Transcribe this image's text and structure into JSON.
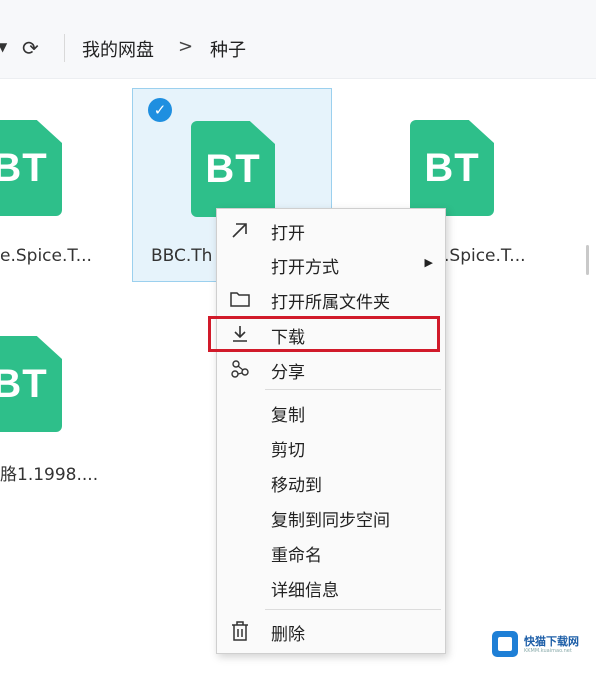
{
  "toolbar": {
    "dropdown_arrow": "▼",
    "refresh_glyph": "⟳",
    "breadcrumb": [
      "我的网盘",
      ">",
      "种子"
    ]
  },
  "files": [
    {
      "icon_text": "BT",
      "name": "e.Spice.T..."
    },
    {
      "icon_text": "BT",
      "name": "BBC.Th",
      "selected": true
    },
    {
      "icon_text": "BT",
      "name": ".Spice.T..."
    },
    {
      "icon_text": "BT",
      "name": "胳1.1998...."
    }
  ],
  "context_menu": {
    "items": [
      {
        "label": "打开",
        "icon": "arrow-up-right-icon"
      },
      {
        "label": "打开方式",
        "has_submenu": true
      },
      {
        "label": "打开所属文件夹",
        "icon": "folder-icon"
      },
      {
        "label": "下载",
        "icon": "download-icon",
        "highlighted": true
      },
      {
        "label": "分享",
        "icon": "share-icon"
      },
      {
        "label": "复制"
      },
      {
        "label": "剪切"
      },
      {
        "label": "移动到"
      },
      {
        "label": "复制到同步空间"
      },
      {
        "label": "重命名"
      },
      {
        "label": "详细信息"
      },
      {
        "label": "删除",
        "icon": "trash-icon"
      }
    ],
    "submenu_arrow": "▶"
  },
  "watermark": {
    "title": "快猫下载网",
    "sub": "KKMM.kuaimao.net"
  },
  "colors": {
    "bt_green": "#2ebf8a",
    "selection_bg": "#e6f3fb",
    "highlight_red": "#d11a2a"
  }
}
